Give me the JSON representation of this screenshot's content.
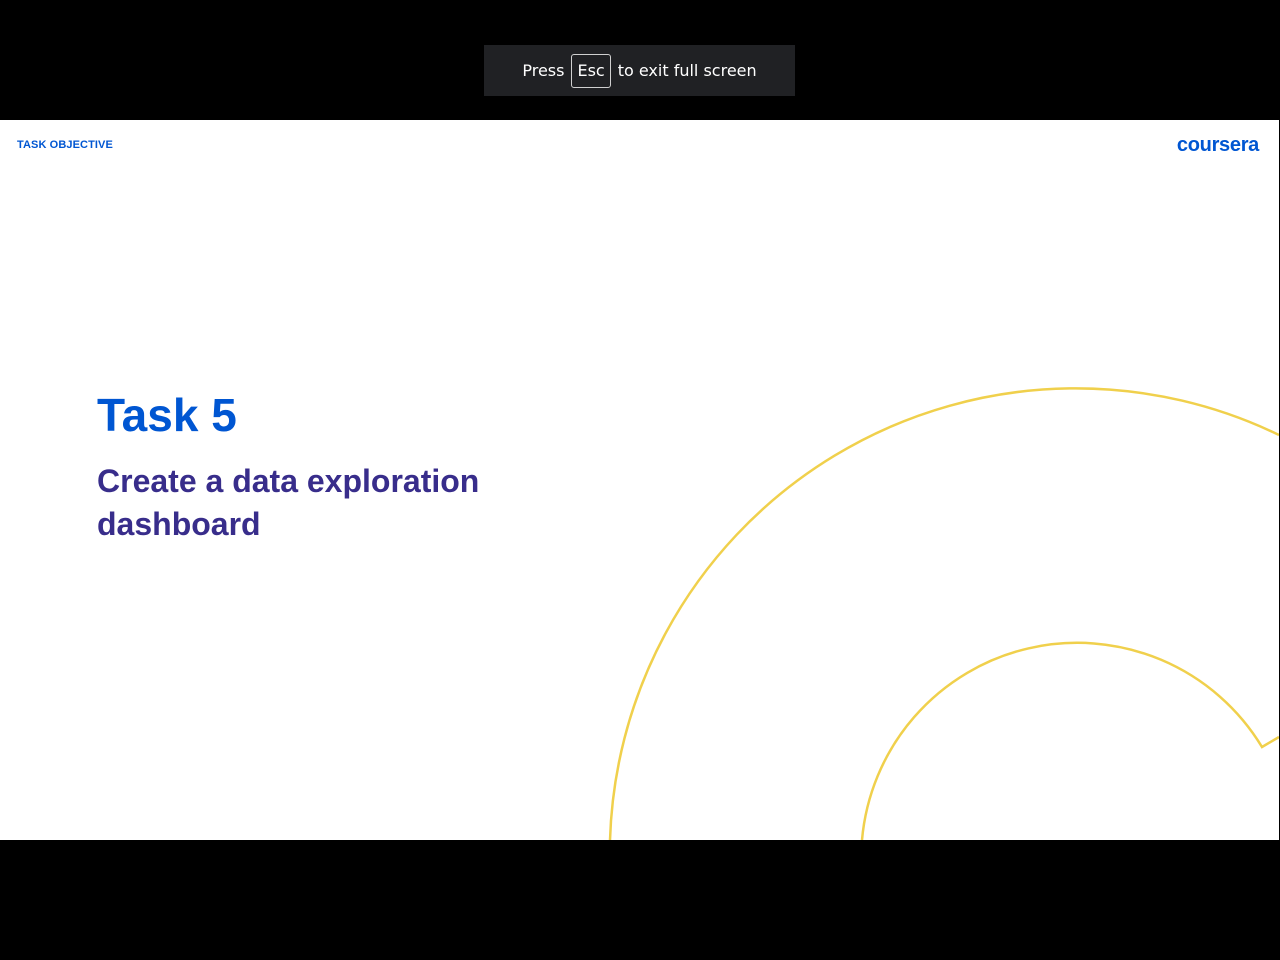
{
  "fullscreen_toast": {
    "press": "Press",
    "key": "Esc",
    "message": "to exit full screen"
  },
  "slide": {
    "label": "TASK OBJECTIVE",
    "logo": "coursera",
    "title": "Task 5",
    "subtitle": "Create a data exploration dashboard"
  },
  "colors": {
    "brand_blue": "#0056d2",
    "subtitle_purple": "#382d8b",
    "decor_yellow": "#f0d04c"
  }
}
